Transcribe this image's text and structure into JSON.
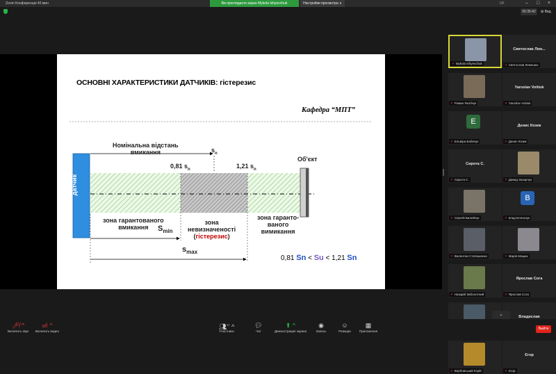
{
  "window": {
    "title": "Zoom Конференція 40 мин",
    "banner": "Ви проглядаєте екран Mykola Ishyevchuk",
    "view_options": "Настройки просмотра ∨",
    "uf": "UF"
  },
  "topbar": {
    "time": "00:35:42",
    "view": "⊞ Вид"
  },
  "slide": {
    "title": "ОСНОВНІ ХАРАКТЕРИСТИКИ  ДАТЧИКІВ: гістерезис",
    "department": "Кафедра “МПТ”",
    "sensor": "датчик",
    "object": "Об'єкт",
    "nominal_1": "Номінальна відстань",
    "nominal_2": "вмикання",
    "sn": "s",
    "sn_sub": "n",
    "s081": "0,81 s",
    "s121": "1,21 s",
    "zone_g1_1": "зона гарантованого",
    "zone_g1_2": "вмикання",
    "smin": "S",
    "smin_sub": "min",
    "zone_u_1": "зона",
    "zone_u_2": "невизначеності",
    "zone_u_3a": "(",
    "zone_u_3b": "гістерезис",
    "zone_u_3c": ")",
    "zone_g2_1": "зона гаранто-",
    "zone_g2_2": "ваного",
    "zone_g2_3": "вимикання",
    "smax": "s",
    "smax_sub": "max",
    "f1": "0,81 ",
    "f_sn": "Sn",
    "f_lt1": " < ",
    "f_su": "Su",
    "f_lt2": " < 1,21 ",
    "f_sn2": "Sn"
  },
  "participants": [
    {
      "name": "",
      "caption": "Mykola Ishyevchuk",
      "type": "photo",
      "active": true,
      "color": "#8a96a8"
    },
    {
      "name": "Святослав  Лем...",
      "caption": "Святослав  Лемешко",
      "type": "name"
    },
    {
      "name": "",
      "caption": "Роман Якобчук",
      "type": "photo",
      "color": "#7a6a58"
    },
    {
      "name": "Yaroslav  Voitiuk",
      "caption": "Yaroslav Voitiuk",
      "type": "name"
    },
    {
      "name": "E",
      "caption": "Ельвіра Бабачук",
      "type": "avatar",
      "color": "#2f6a3c"
    },
    {
      "name": "Денис  Козик",
      "caption": "Денис Козик",
      "type": "name"
    },
    {
      "name": "Сирота С.",
      "caption": "Сирота С.",
      "type": "name"
    },
    {
      "name": "",
      "caption": "Давид Захарчук",
      "type": "photo",
      "color": "#9a8a6a"
    },
    {
      "name": "",
      "caption": "Сергей Билейчук",
      "type": "photo",
      "color": "#7a7468"
    },
    {
      "name": "B",
      "caption": "влад Блоньчук",
      "type": "avatar",
      "color": "#2a64b4"
    },
    {
      "name": "",
      "caption": "Валентин Степашенко",
      "type": "photo",
      "color": "#5a5e66"
    },
    {
      "name": "",
      "caption": "Марія Мацюк",
      "type": "photo",
      "color": "#8c8890"
    },
    {
      "name": "",
      "caption": "Назарій Заболотний",
      "type": "photo",
      "color": "#6a7a4a"
    },
    {
      "name": "Ярослав Сога",
      "caption": "Ярослав Сога",
      "type": "name"
    },
    {
      "name": "",
      "caption": "Бутенко",
      "type": "photo",
      "color": "#4a5a66"
    },
    {
      "name": "Владислав",
      "caption": "Владислав",
      "type": "name"
    },
    {
      "name": "",
      "caption": "Вербовський Юрій",
      "type": "photo",
      "color": "#b48a2a"
    },
    {
      "name": "Єгор",
      "caption": "Єгор",
      "type": "name"
    }
  ],
  "toolbar": {
    "mute": "Включить звук",
    "video": "Включить видео",
    "participants": "Участники",
    "participants_count": "37",
    "chat": "Чат",
    "share": "Демонстрация экрана",
    "record": "Запись",
    "reactions": "Реакции",
    "apps": "Приложения",
    "end": "Выйти"
  }
}
